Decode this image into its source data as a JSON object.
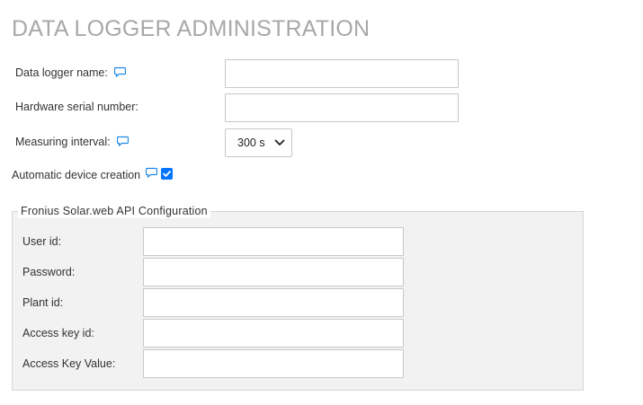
{
  "page": {
    "title": "DATA LOGGER ADMINISTRATION"
  },
  "form": {
    "logger_name_label": "Data logger name:",
    "logger_name_value": "",
    "serial_label": "Hardware serial number:",
    "serial_value": "",
    "interval_label": "Measuring interval:",
    "interval_selected": "300 s",
    "auto_device_label": "Automatic device creation",
    "auto_device_checked": true
  },
  "api_config": {
    "legend": "Fronius Solar.web API Configuration",
    "user_id_label": "User id:",
    "password_label": "Password:",
    "plant_id_label": "Plant id:",
    "access_key_id_label": "Access key id:",
    "access_key_value_label": "Access Key Value:"
  },
  "icons": {
    "comment": "comment-bubble-icon",
    "dropdown": "chevron-down-icon",
    "check": "checkmark-icon"
  },
  "colors": {
    "title": "#a8a8a8",
    "icon_blue": "#1e88e5",
    "checkbox_blue": "#0075ff",
    "fieldset_bg": "#f2f2f2"
  }
}
